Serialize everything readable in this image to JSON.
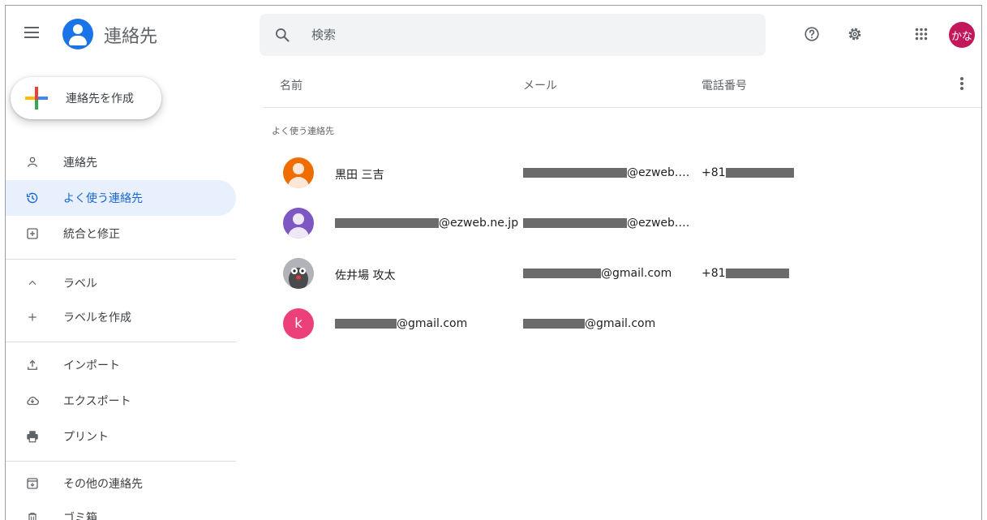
{
  "header": {
    "app_title": "連絡先",
    "search_placeholder": "検索",
    "account_initials": "かな",
    "icons": [
      "menu-icon",
      "contacts-logo-icon",
      "search-icon",
      "help-icon",
      "settings-icon",
      "apps-grid-icon"
    ]
  },
  "sidebar": {
    "create_label": "連絡先を作成",
    "items": [
      {
        "label": "連絡先",
        "icon": "person-icon"
      },
      {
        "label": "よく使う連絡先",
        "icon": "history-icon"
      },
      {
        "label": "統合と修正",
        "icon": "merge-icon"
      },
      {
        "label": "ラベル",
        "icon": "chevron-up-icon"
      },
      {
        "label": "ラベルを作成",
        "icon": "plus-icon"
      },
      {
        "label": "インポート",
        "icon": "upload-icon"
      },
      {
        "label": "エクスポート",
        "icon": "cloud-download-icon"
      },
      {
        "label": "プリント",
        "icon": "printer-icon"
      },
      {
        "label": "その他の連絡先",
        "icon": "archive-icon"
      },
      {
        "label": "ゴミ箱",
        "icon": "trash-icon"
      }
    ],
    "active_item": "よく使う連絡先"
  },
  "list": {
    "columns": {
      "name": "名前",
      "email": "メール",
      "phone": "電話番号"
    },
    "section_label": "よく使う連絡先",
    "rows": [
      {
        "name": "黒田 三吉",
        "email_suffix": "@ezweb.n...",
        "phone_prefix": "+81",
        "avatar": "orange"
      },
      {
        "name_suffix": "@ezweb.ne.jp",
        "email_suffix": "@ezweb.n...",
        "avatar": "purple"
      },
      {
        "name": "佐井場 攻太",
        "email_suffix": "@gmail.com",
        "phone_prefix": "+81",
        "avatar": "photo"
      },
      {
        "name_suffix": "@gmail.com",
        "email_suffix": "@gmail.com",
        "avatar": "letter",
        "avatar_letter": "k"
      }
    ]
  },
  "colors": {
    "accent": "#1a73e8",
    "active_bg": "#e8f0fe",
    "active_text": "#1967d2",
    "account_avatar": "#c2185b",
    "avatar_orange": "#ef6c00",
    "avatar_purple": "#7e57c2",
    "avatar_pink": "#ec407a"
  }
}
